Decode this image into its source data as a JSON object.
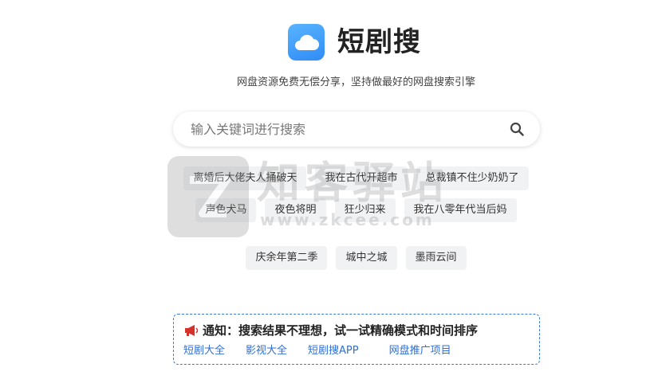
{
  "header": {
    "app_name": "短剧搜",
    "tagline": "网盘资源免费无偿分享，坚持做最好的网盘搜索引擎",
    "logo_icon": "cloud-icon",
    "brand_color": "#2f8cf5"
  },
  "search": {
    "placeholder": "输入关键词进行搜索",
    "value": "",
    "button_icon": "search-icon"
  },
  "hot_tags": {
    "row1": [
      "离婚后大佬夫人捅破天",
      "我在古代开超市",
      "总裁镇不住少奶奶了"
    ],
    "row2": [
      "声色犬马",
      "夜色将明",
      "狂少归来",
      "我在八零年代当后妈"
    ],
    "row3": [
      "庆余年第二季",
      "城中之城",
      "墨雨云间"
    ]
  },
  "watermark": {
    "title": "知客驿站",
    "url": "www.zkcee.com"
  },
  "notice": {
    "icon": "megaphone-icon",
    "title": "通知：搜索结果不理想，试一试精确模式和时间排序",
    "links": [
      "短剧大全",
      "影视大全",
      "短剧搜APP",
      "网盘推广项目"
    ],
    "link_color": "#2f6fd6",
    "border_color": "#3a7bd5"
  }
}
